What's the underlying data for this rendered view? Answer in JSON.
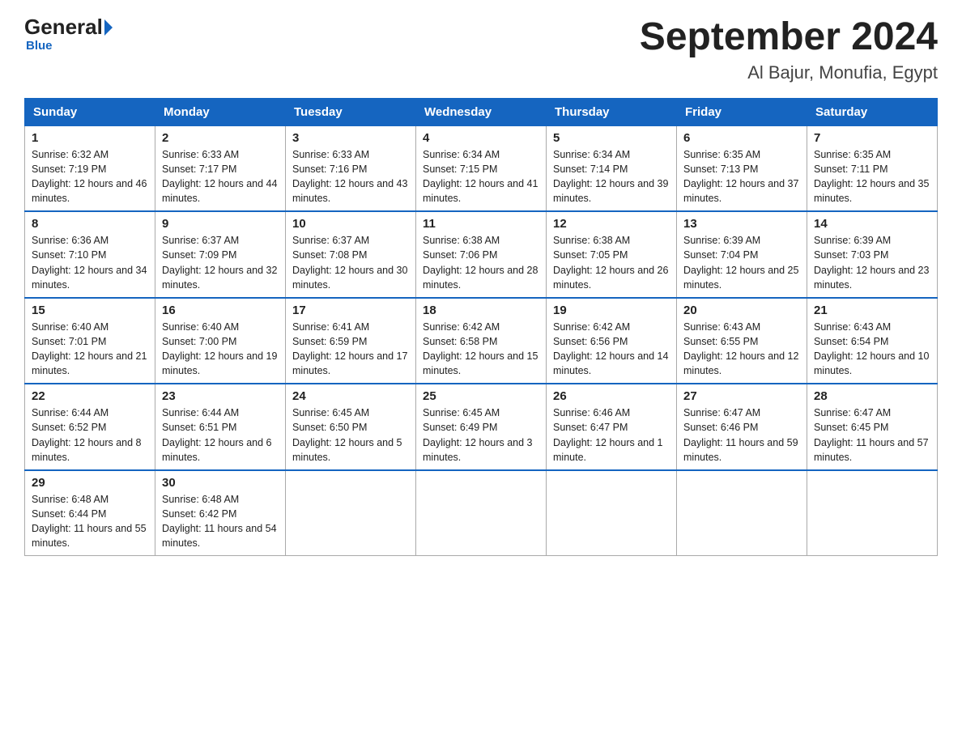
{
  "logo": {
    "name": "General",
    "blue": "Blue"
  },
  "title": "September 2024",
  "subtitle": "Al Bajur, Monufia, Egypt",
  "days": [
    "Sunday",
    "Monday",
    "Tuesday",
    "Wednesday",
    "Thursday",
    "Friday",
    "Saturday"
  ],
  "weeks": [
    [
      {
        "num": "1",
        "sunrise": "6:32 AM",
        "sunset": "7:19 PM",
        "daylight": "12 hours and 46 minutes."
      },
      {
        "num": "2",
        "sunrise": "6:33 AM",
        "sunset": "7:17 PM",
        "daylight": "12 hours and 44 minutes."
      },
      {
        "num": "3",
        "sunrise": "6:33 AM",
        "sunset": "7:16 PM",
        "daylight": "12 hours and 43 minutes."
      },
      {
        "num": "4",
        "sunrise": "6:34 AM",
        "sunset": "7:15 PM",
        "daylight": "12 hours and 41 minutes."
      },
      {
        "num": "5",
        "sunrise": "6:34 AM",
        "sunset": "7:14 PM",
        "daylight": "12 hours and 39 minutes."
      },
      {
        "num": "6",
        "sunrise": "6:35 AM",
        "sunset": "7:13 PM",
        "daylight": "12 hours and 37 minutes."
      },
      {
        "num": "7",
        "sunrise": "6:35 AM",
        "sunset": "7:11 PM",
        "daylight": "12 hours and 35 minutes."
      }
    ],
    [
      {
        "num": "8",
        "sunrise": "6:36 AM",
        "sunset": "7:10 PM",
        "daylight": "12 hours and 34 minutes."
      },
      {
        "num": "9",
        "sunrise": "6:37 AM",
        "sunset": "7:09 PM",
        "daylight": "12 hours and 32 minutes."
      },
      {
        "num": "10",
        "sunrise": "6:37 AM",
        "sunset": "7:08 PM",
        "daylight": "12 hours and 30 minutes."
      },
      {
        "num": "11",
        "sunrise": "6:38 AM",
        "sunset": "7:06 PM",
        "daylight": "12 hours and 28 minutes."
      },
      {
        "num": "12",
        "sunrise": "6:38 AM",
        "sunset": "7:05 PM",
        "daylight": "12 hours and 26 minutes."
      },
      {
        "num": "13",
        "sunrise": "6:39 AM",
        "sunset": "7:04 PM",
        "daylight": "12 hours and 25 minutes."
      },
      {
        "num": "14",
        "sunrise": "6:39 AM",
        "sunset": "7:03 PM",
        "daylight": "12 hours and 23 minutes."
      }
    ],
    [
      {
        "num": "15",
        "sunrise": "6:40 AM",
        "sunset": "7:01 PM",
        "daylight": "12 hours and 21 minutes."
      },
      {
        "num": "16",
        "sunrise": "6:40 AM",
        "sunset": "7:00 PM",
        "daylight": "12 hours and 19 minutes."
      },
      {
        "num": "17",
        "sunrise": "6:41 AM",
        "sunset": "6:59 PM",
        "daylight": "12 hours and 17 minutes."
      },
      {
        "num": "18",
        "sunrise": "6:42 AM",
        "sunset": "6:58 PM",
        "daylight": "12 hours and 15 minutes."
      },
      {
        "num": "19",
        "sunrise": "6:42 AM",
        "sunset": "6:56 PM",
        "daylight": "12 hours and 14 minutes."
      },
      {
        "num": "20",
        "sunrise": "6:43 AM",
        "sunset": "6:55 PM",
        "daylight": "12 hours and 12 minutes."
      },
      {
        "num": "21",
        "sunrise": "6:43 AM",
        "sunset": "6:54 PM",
        "daylight": "12 hours and 10 minutes."
      }
    ],
    [
      {
        "num": "22",
        "sunrise": "6:44 AM",
        "sunset": "6:52 PM",
        "daylight": "12 hours and 8 minutes."
      },
      {
        "num": "23",
        "sunrise": "6:44 AM",
        "sunset": "6:51 PM",
        "daylight": "12 hours and 6 minutes."
      },
      {
        "num": "24",
        "sunrise": "6:45 AM",
        "sunset": "6:50 PM",
        "daylight": "12 hours and 5 minutes."
      },
      {
        "num": "25",
        "sunrise": "6:45 AM",
        "sunset": "6:49 PM",
        "daylight": "12 hours and 3 minutes."
      },
      {
        "num": "26",
        "sunrise": "6:46 AM",
        "sunset": "6:47 PM",
        "daylight": "12 hours and 1 minute."
      },
      {
        "num": "27",
        "sunrise": "6:47 AM",
        "sunset": "6:46 PM",
        "daylight": "11 hours and 59 minutes."
      },
      {
        "num": "28",
        "sunrise": "6:47 AM",
        "sunset": "6:45 PM",
        "daylight": "11 hours and 57 minutes."
      }
    ],
    [
      {
        "num": "29",
        "sunrise": "6:48 AM",
        "sunset": "6:44 PM",
        "daylight": "11 hours and 55 minutes."
      },
      {
        "num": "30",
        "sunrise": "6:48 AM",
        "sunset": "6:42 PM",
        "daylight": "11 hours and 54 minutes."
      },
      null,
      null,
      null,
      null,
      null
    ]
  ]
}
